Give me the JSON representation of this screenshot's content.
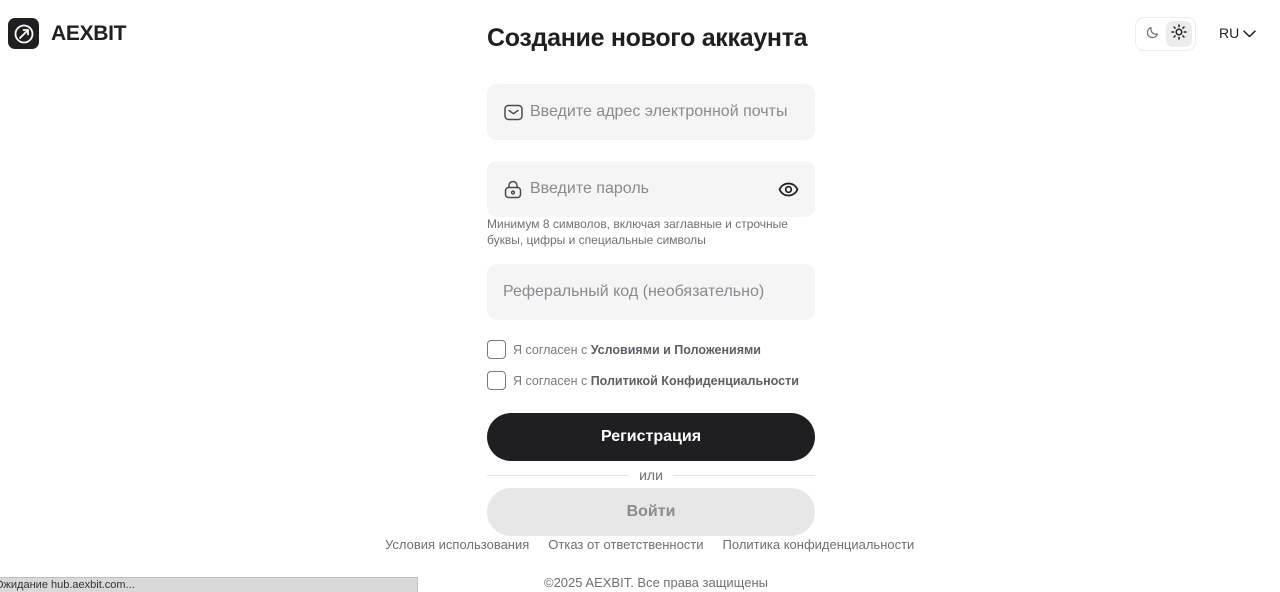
{
  "brand": {
    "name": "AEXBIT",
    "logo_icon": "rocket-icon"
  },
  "header": {
    "theme_dark_icon": "moon-icon",
    "theme_light_icon": "sun-icon",
    "language": "RU"
  },
  "form": {
    "title": "Создание нового аккаунта",
    "email_placeholder": "Введите адрес электронной почты",
    "password_placeholder": "Введите пароль",
    "password_hint": "Минимум 8 символов, включая заглавные и строчные буквы, цифры и специальные символы",
    "referral_placeholder": "Реферальный код (необязательно)",
    "terms_prefix": "Я согласен с ",
    "terms_link": "Условиями и Положениями",
    "privacy_prefix": "Я согласен с ",
    "privacy_link": "Политикой Конфиденциальности",
    "register_label": "Регистрация",
    "or_label": "или",
    "login_label": "Войти"
  },
  "footer": {
    "links": [
      "Условия использования",
      "Отказ от ответственности",
      "Политика конфиденциальности"
    ],
    "copyright": "©2025 AEXBIT. Все права защищены"
  },
  "status_bar": {
    "text": "Ожидание hub.aexbit.com..."
  },
  "colors": {
    "primary": "#1f1f22",
    "field_bg": "#f5f5f5",
    "secondary_btn": "#e7e7e7",
    "muted_text": "#6f6f74"
  }
}
